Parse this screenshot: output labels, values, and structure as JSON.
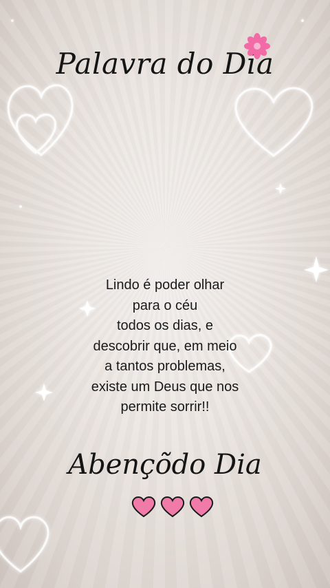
{
  "header": {
    "title": "Palavra do Dia"
  },
  "message": {
    "lines": [
      "Lindo é poder olhar",
      "para o céu",
      "todos os dias, e",
      "descobrir que, em meio",
      "a tantos problemas,",
      "existe um Deus que nos",
      "permite sorrir!!"
    ]
  },
  "footer": {
    "blessing": "Abençõdo Dia"
  },
  "colors": {
    "heart_pink": "#f07aa8",
    "flower_pink": "#f26aa6",
    "text": "#1a1a1a"
  },
  "icons": [
    "flower-icon",
    "heart-icon",
    "sparkle-icon",
    "outline-heart-icon"
  ]
}
